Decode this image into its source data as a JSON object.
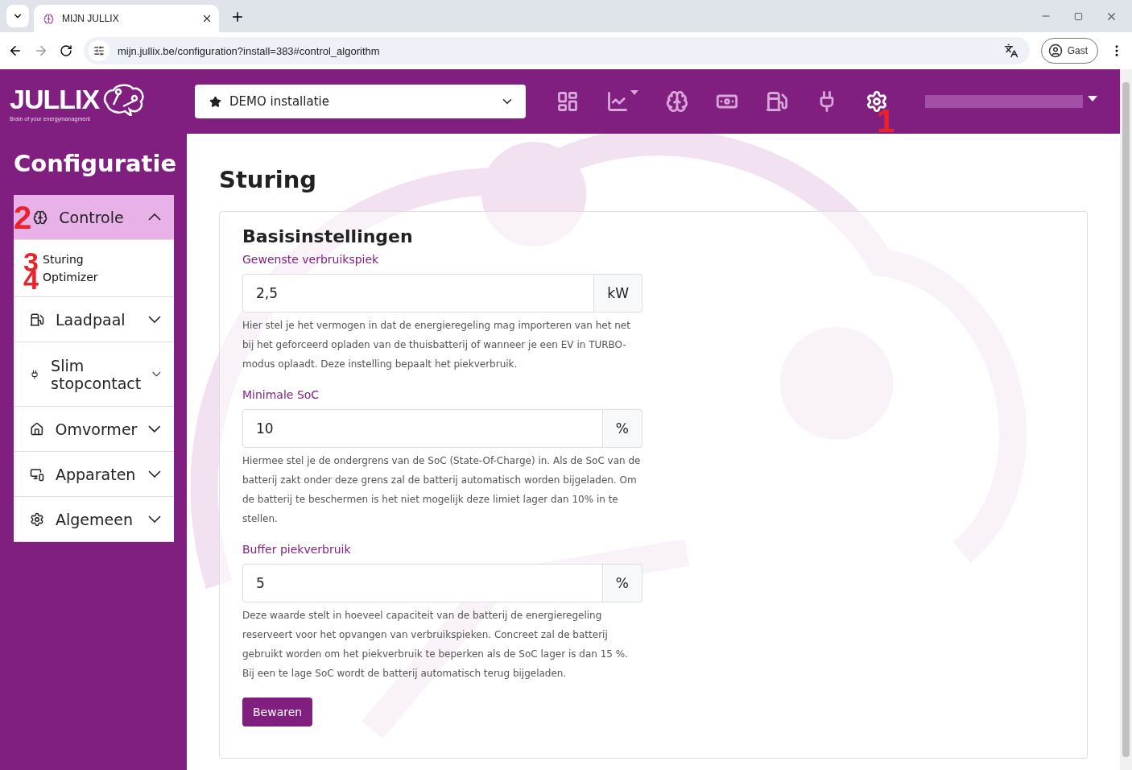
{
  "browser": {
    "tab_title": "MIJN JULLIX",
    "url": "mijn.jullix.be/configuration?install=383#control_algorithm",
    "profile": "Gast"
  },
  "header": {
    "logo_text": "JULLIX",
    "logo_tagline": "Brain of your energymanagment",
    "installation": "DEMO installatie",
    "nav": [
      {
        "selected": false,
        "caret": false
      },
      {
        "selected": false,
        "caret": true
      },
      {
        "selected": false,
        "caret": false
      },
      {
        "selected": false,
        "caret": false
      },
      {
        "selected": false,
        "caret": false
      },
      {
        "selected": false,
        "caret": false
      },
      {
        "selected": true,
        "caret": false,
        "annotation": "1"
      }
    ]
  },
  "sidebar": {
    "title": "Configuratie",
    "items": [
      {
        "label": "Controle",
        "expanded": true,
        "annotation": "2",
        "children": [
          {
            "label": "Sturing",
            "annotation": "3"
          },
          {
            "label": "Optimizer",
            "annotation": "4"
          }
        ]
      },
      {
        "label": "Laadpaal",
        "expanded": false
      },
      {
        "label": "Slim stopcontact",
        "expanded": false
      },
      {
        "label": "Omvormer",
        "expanded": false
      },
      {
        "label": "Apparaten",
        "expanded": false
      },
      {
        "label": "Algemeen",
        "expanded": false
      }
    ]
  },
  "page": {
    "title": "Sturing",
    "card_title": "Basisinstellingen",
    "fields": [
      {
        "label": "Gewenste verbruikspiek",
        "value": "2,5",
        "unit": "kW",
        "help": "Hier stel je het vermogen in dat de energieregeling mag importeren van het net bij het geforceerd opladen van de thuisbatterij of wanneer je een EV in TURBO-modus oplaadt. Deze instelling bepaalt het piekverbruik."
      },
      {
        "label": "Minimale SoC",
        "value": "10",
        "unit": "%",
        "help": "Hiermee stel je de ondergrens van de SoC (State-Of-Charge) in. Als de SoC van de batterij zakt onder deze grens zal de batterij automatisch worden bijgeladen. Om de batterij te beschermen is het niet mogelijk deze limiet lager dan 10% in te stellen."
      },
      {
        "label": "Buffer piekverbruik",
        "value": "5",
        "unit": "%",
        "help": "Deze waarde stelt in hoeveel capaciteit van de batterij de energieregeling reserveert voor het opvangen van verbruikspieken. Concreet zal de batterij gebruikt worden om het piekverbruik te beperken als de SoC lager is dan 15 %. Bij een te lage SoC wordt de batterij automatisch terug bijgeladen."
      }
    ],
    "save_button": "Bewaren"
  }
}
